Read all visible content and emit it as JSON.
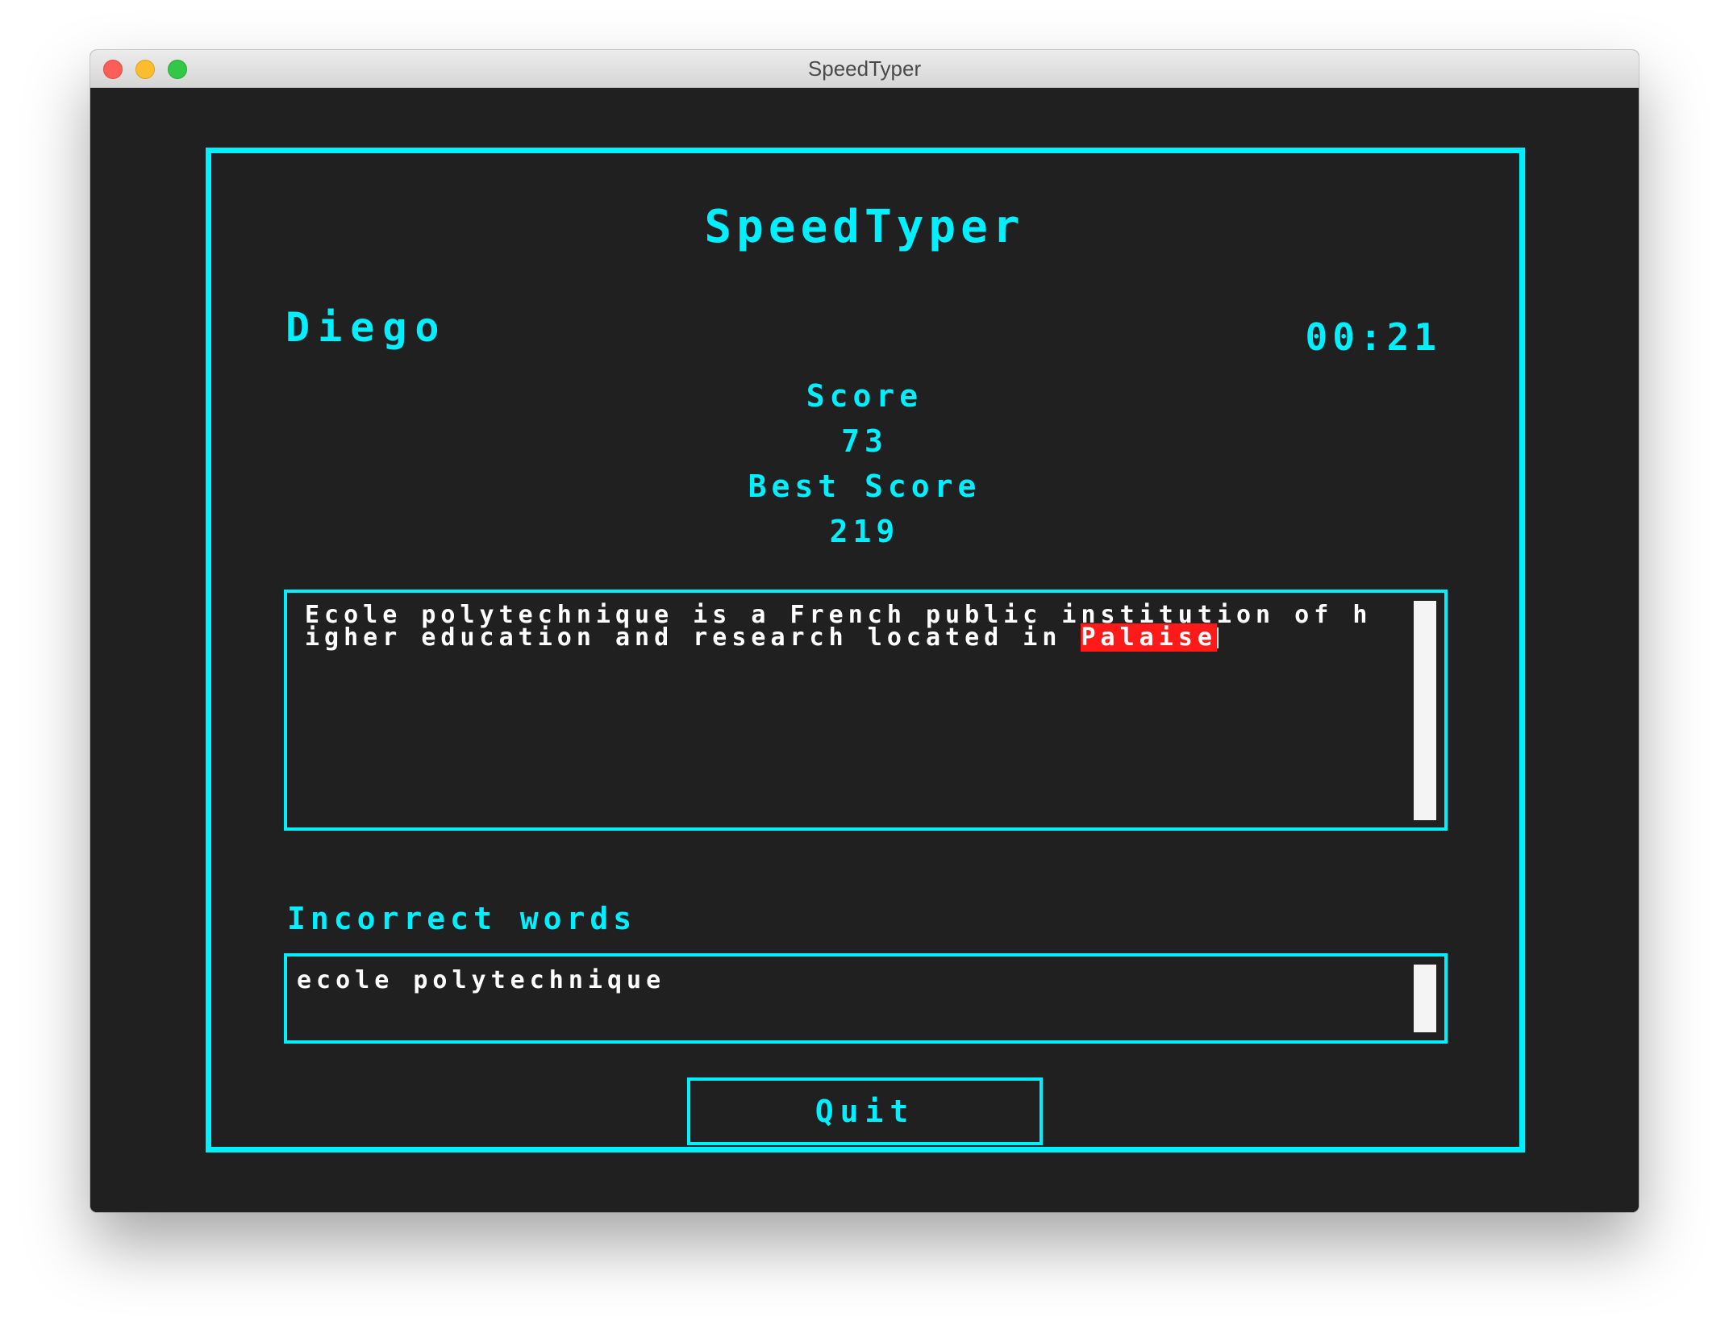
{
  "window": {
    "title": "SpeedTyper"
  },
  "app": {
    "title": "SpeedTyper",
    "player_name": "Diego",
    "timer": "00:21",
    "score_label": "Score",
    "score_value": "73",
    "best_score_label": "Best Score",
    "best_score_value": "219"
  },
  "typing": {
    "text_before": "Ecole polytechnique is a French public institution of higher education and research located in ",
    "current_word": "Palaise"
  },
  "incorrect": {
    "label": "Incorrect words",
    "words": "ecole polytechnique"
  },
  "actions": {
    "quit_label": "Quit"
  },
  "colors": {
    "accent": "#00f0ff",
    "background": "#202020",
    "text": "#ffffff",
    "error_highlight": "#ff1a1a"
  }
}
